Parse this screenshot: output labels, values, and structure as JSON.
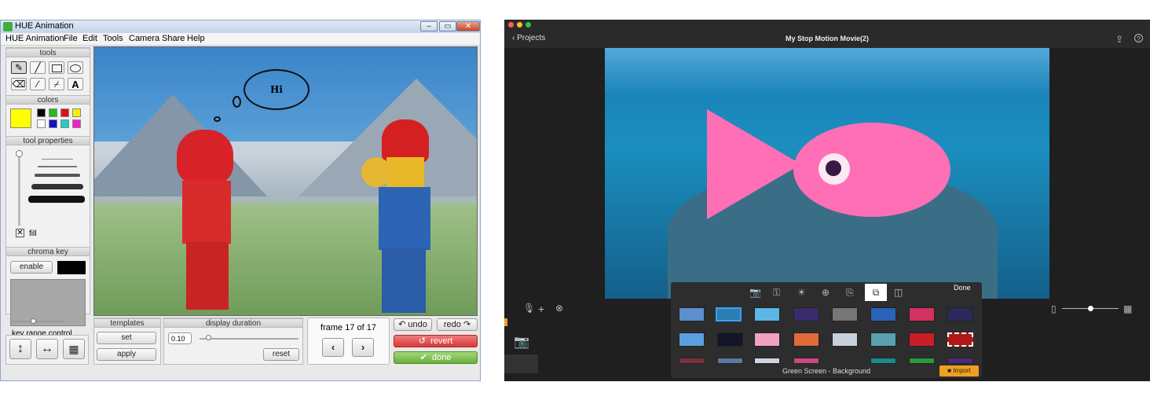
{
  "hue": {
    "title": "HUE Animation",
    "window_buttons": [
      "–",
      "▭",
      "✕"
    ],
    "menu": [
      "HUE Animation",
      "File",
      "Edit",
      "Tools",
      "Camera",
      "Share",
      "Help"
    ],
    "tools_header": "tools",
    "tool_icons": [
      "pencil-icon",
      "line-icon",
      "rectangle-icon",
      "ellipse-icon",
      "eraser-icon",
      "magic-wand-icon",
      "eyedropper-icon",
      "text-icon"
    ],
    "text_tool_glyph": "A",
    "colors_header": "colors",
    "selected_color": "#ffff00",
    "palette": [
      "#000000",
      "#22bb22",
      "#dd1111",
      "#ffee00",
      "#ffffff",
      "#1111cc",
      "#22cccc",
      "#ee22cc"
    ],
    "tool_properties_header": "tool properties",
    "fill_label": "fill",
    "chroma_key_header": "chroma key",
    "enable_label": "enable",
    "chroma_color": "#000000",
    "key_range_label": "key range control",
    "templates_header": "templates",
    "set_label": "set",
    "apply_label": "apply",
    "display_duration_header": "display duration",
    "duration_value": "0.10",
    "reset_label": "reset",
    "frame_label": "frame 17 of 17",
    "undo_label": "undo",
    "redo_label": "redo",
    "revert_label": "revert",
    "done_label": "done",
    "speech_bubble_text": "Hi"
  },
  "stopmotion": {
    "back_label": "Projects",
    "title": "My Stop Motion Movie(2)",
    "done_label": "Done",
    "panel_caption": "Green Screen - Background",
    "import_label": "Import",
    "toolbar_icons": [
      "camera-icon",
      "key-icon",
      "brightness-icon",
      "zoom-icon",
      "import-frame-icon",
      "overlay-icon",
      "split-icon"
    ],
    "thumb_colors": [
      [
        "#5d8fd0",
        "#2b7fb0",
        "#5ab7e8",
        "#3a2a6a",
        "#777777",
        "#2a64b8",
        "#d43060",
        "#2a2a5a"
      ],
      [
        "#5aa0e0",
        "#15152a",
        "#f0a0c0",
        "#e06a3a",
        "#c8d0dc",
        "#5aa0b0",
        "#c81e2a",
        "#b01818"
      ],
      [
        "#7a3040",
        "#5a7aa0",
        "#cfd6df",
        "#c84a80",
        "#1a8a8a",
        "#2a9a3a",
        "#4a2a7a",
        "#"
      ]
    ]
  }
}
